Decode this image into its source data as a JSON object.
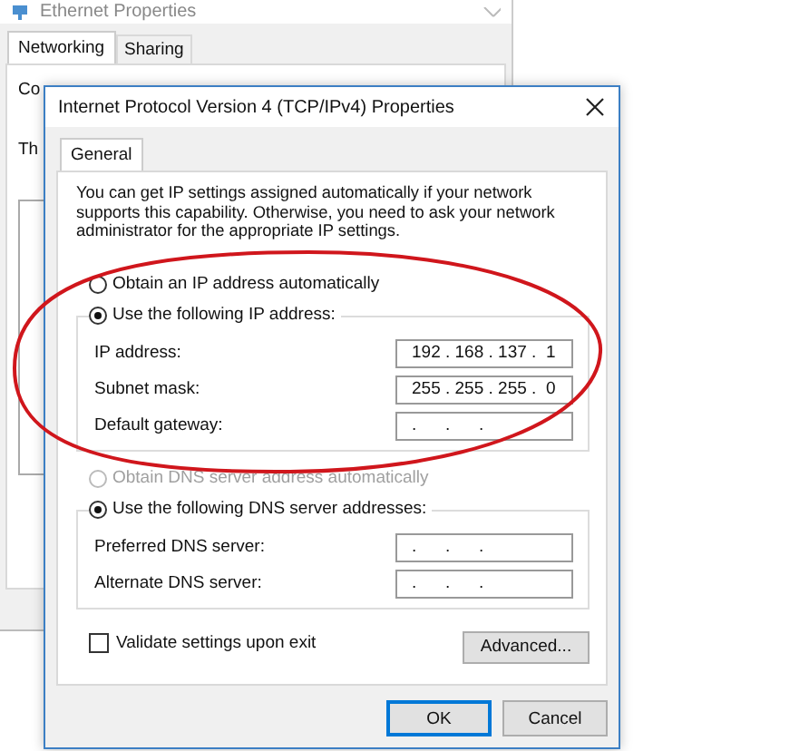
{
  "background_window": {
    "title": "Ethernet Properties",
    "tabs": [
      {
        "label": "Networking",
        "selected": true
      },
      {
        "label": "Sharing",
        "selected": false
      }
    ],
    "fragments": [
      "Co",
      "Th"
    ]
  },
  "dialog": {
    "title": "Internet Protocol Version 4 (TCP/IPv4) Properties",
    "tabs": [
      {
        "label": "General",
        "selected": true
      }
    ],
    "description": "You can get IP settings assigned automatically if your network supports this capability. Otherwise, you need to ask your network administrator for the appropriate IP settings.",
    "ip_options": [
      {
        "label": "Obtain an IP address automatically",
        "selected": false,
        "disabled": false
      },
      {
        "label": "Use the following IP address:",
        "selected": true,
        "disabled": false
      }
    ],
    "ip_fields": [
      {
        "label": "IP address:",
        "value": "192 . 168 . 137 .  1"
      },
      {
        "label": "Subnet mask:",
        "value": "255 . 255 . 255 .  0"
      },
      {
        "label": "Default gateway:",
        "value": ".      .      ."
      }
    ],
    "dns_options": [
      {
        "label": "Obtain DNS server address automatically",
        "selected": false,
        "disabled": true
      },
      {
        "label": "Use the following DNS server addresses:",
        "selected": true,
        "disabled": false
      }
    ],
    "dns_fields": [
      {
        "label": "Preferred DNS server:",
        "value": ".      .      ."
      },
      {
        "label": "Alternate DNS server:",
        "value": ".      .      ."
      }
    ],
    "validate": {
      "label": "Validate settings upon exit",
      "checked": false
    },
    "advanced_button": "Advanced...",
    "buttons": [
      {
        "label": "OK",
        "default": true
      },
      {
        "label": "Cancel",
        "default": false
      }
    ]
  },
  "annotation": {
    "kind": "ellipse",
    "color": "#d0161c"
  }
}
